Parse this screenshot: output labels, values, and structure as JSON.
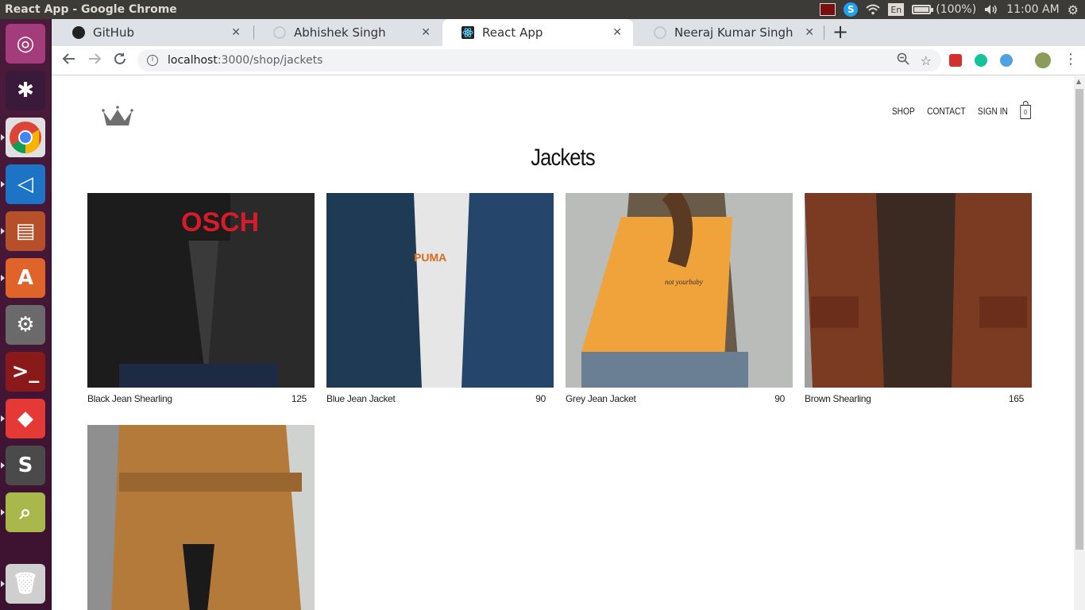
{
  "os": {
    "window_title": "React App - Google Chrome",
    "language": "En",
    "battery": "(100%)",
    "battery_level": 1.0,
    "time": "11:00 AM"
  },
  "launcher": {
    "apps": [
      {
        "name": "ubuntu-dash-icon",
        "color": "#a33c7a"
      },
      {
        "name": "slack-icon",
        "color": "#3a1a3a"
      },
      {
        "name": "chrome-icon",
        "color": "#e0e0e0"
      },
      {
        "name": "vscode-icon",
        "color": "#1e74c4"
      },
      {
        "name": "files-icon",
        "color": "#b5502a"
      },
      {
        "name": "software-center-icon",
        "color": "#e0642a"
      },
      {
        "name": "system-settings-icon",
        "color": "#6a6a6a"
      },
      {
        "name": "terminal-icon",
        "color": "#8a1a1a"
      },
      {
        "name": "anydesk-icon",
        "color": "#e53935"
      },
      {
        "name": "sublime-text-icon",
        "color": "#4a4a4a"
      },
      {
        "name": "search-tool-icon",
        "color": "#a8b84a"
      },
      {
        "name": "trash-icon",
        "color": "#cfcfcf"
      }
    ]
  },
  "browser": {
    "tabs": [
      {
        "label": "GitHub",
        "active": false,
        "favicon_color": "#222222"
      },
      {
        "label": "Abhishek Singh",
        "active": false,
        "favicon_color": "#c8c8c8"
      },
      {
        "label": "React App",
        "active": true,
        "favicon_color": "#20232a"
      },
      {
        "label": "Neeraj Kumar Singh",
        "active": false,
        "favicon_color": "#c8c8c8"
      }
    ],
    "url_host": "localhost",
    "url_path": ":3000/shop/jackets",
    "extensions": [
      {
        "name": "extension-red-icon",
        "color": "#d32f2f"
      },
      {
        "name": "grammarly-icon",
        "color": "#15c39a"
      },
      {
        "name": "extension-blue-icon",
        "color": "#4fa3e0"
      }
    ]
  },
  "site": {
    "nav": {
      "shop": "SHOP",
      "contact": "CONTACT",
      "sign_in": "SIGN IN",
      "cart_count": "0"
    },
    "title": "Jackets",
    "items": [
      {
        "name": "Black Jean Shearling",
        "price": "125",
        "colors": [
          "#1c1c1c",
          "#2a2a2a",
          "#d81b2a"
        ]
      },
      {
        "name": "Blue Jean Jacket",
        "price": "90",
        "colors": [
          "#1f3a55",
          "#e6e6e6",
          "#d66a1e"
        ]
      },
      {
        "name": "Grey Jean Jacket",
        "price": "90",
        "colors": [
          "#b9bcb8",
          "#f0a33a",
          "#6a7f93"
        ]
      },
      {
        "name": "Brown Shearling",
        "price": "165",
        "colors": [
          "#7a3b22",
          "#3a2a22",
          "#a0a0a0"
        ]
      },
      {
        "name": "",
        "price": "",
        "colors": [
          "#b47a3a",
          "#8f8f8f",
          "#cfd2cf"
        ]
      }
    ]
  }
}
